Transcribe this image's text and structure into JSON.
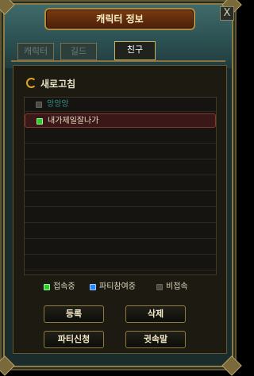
{
  "window": {
    "title": "캐릭터 정보",
    "close_label": "X"
  },
  "tabs": [
    {
      "label": "캐릭터"
    },
    {
      "label": "길드"
    },
    {
      "label": "친구",
      "active": true
    }
  ],
  "refresh": {
    "label": "새로고침"
  },
  "friends": [
    {
      "name": "앙앙앙",
      "status": "offline"
    },
    {
      "name": "내가제일잘나가",
      "status": "online",
      "selected": true
    }
  ],
  "legend": {
    "online": "접속중",
    "party": "파티참여중",
    "offline": "비접속"
  },
  "buttons": {
    "add": "등록",
    "delete": "삭제",
    "party": "파티신청",
    "whisper": "귓속말"
  },
  "colors": {
    "online": "#2ecb2e",
    "party": "#2a86ff",
    "offline": "#4a4a46"
  }
}
